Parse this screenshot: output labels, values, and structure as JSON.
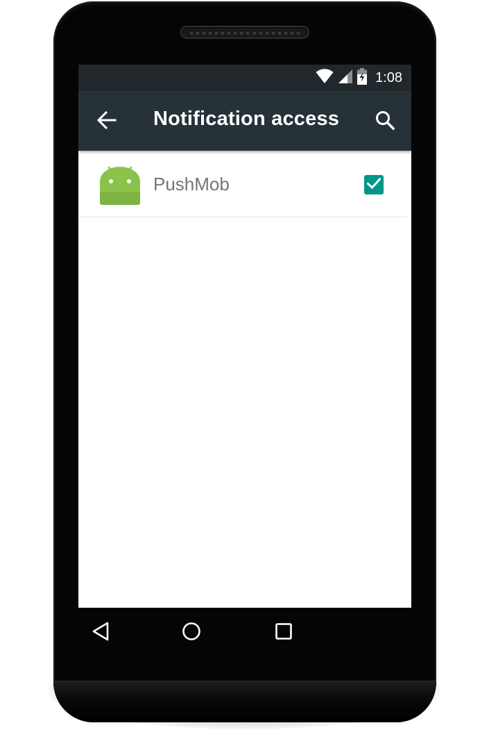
{
  "status_bar": {
    "time": "1:08",
    "icons": [
      "wifi-icon",
      "signal-icon",
      "battery-charging-icon"
    ]
  },
  "app_bar": {
    "title": "Notification access",
    "back_icon": "arrow-back-icon",
    "search_icon": "search-icon",
    "background": "#263238"
  },
  "list": {
    "items": [
      {
        "icon": "android-app-icon",
        "label": "PushMob",
        "checked": true
      }
    ]
  },
  "nav_bar": {
    "icons": [
      "back-triangle-icon",
      "home-circle-icon",
      "recents-square-icon"
    ]
  },
  "colors": {
    "accent": "#009688",
    "status_bar": "#21272b",
    "android_green": "#8bc34a"
  }
}
